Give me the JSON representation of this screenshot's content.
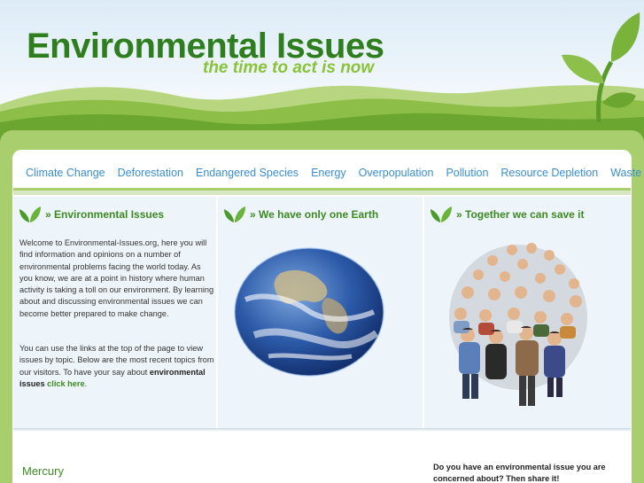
{
  "header": {
    "title": "Environmental Issues",
    "tagline": "the time to act is now"
  },
  "colors": {
    "brand_green": "#2e7d1f",
    "tagline_green": "#8ac238",
    "frame_green": "#a9ce6e",
    "nav_link_blue": "#3a8ed0",
    "panel_bg": "#eef5fa"
  },
  "nav": {
    "items": [
      {
        "label": "Climate Change"
      },
      {
        "label": "Deforestation"
      },
      {
        "label": "Endangered Species"
      },
      {
        "label": "Energy"
      },
      {
        "label": "Overpopulation"
      },
      {
        "label": "Pollution"
      },
      {
        "label": "Resource Depletion"
      },
      {
        "label": "Waste"
      }
    ]
  },
  "columns": [
    {
      "icon": "leaf-icon",
      "heading": "» Environmental Issues",
      "paragraph1": "Welcome to Environmental-Issues.org, here you will find information and opinions on a number of environmental problems facing the world today. As you know, we are at a point in history where human activity is taking a toll on our environment. By learning about and discussing environmental issues we can become better prepared to make change.",
      "paragraph2_lead": "You can use the links at the top of the page to view issues by topic. Below are the most recent topics from our visitors. To have your say about ",
      "paragraph2_bold": "environmental issues",
      "paragraph2_link": "click here",
      "paragraph2_end": "."
    },
    {
      "icon": "leaf-icon",
      "heading": "» We have only one Earth",
      "image": "earth-globe"
    },
    {
      "icon": "leaf-icon",
      "heading": "» Together we can save it",
      "image": "crowd-of-people"
    }
  ],
  "bottom": {
    "topic_title": "Mercury",
    "share_line1": "Do you have an environmental issue you are",
    "share_line2": "concerned about? Then share it!"
  }
}
